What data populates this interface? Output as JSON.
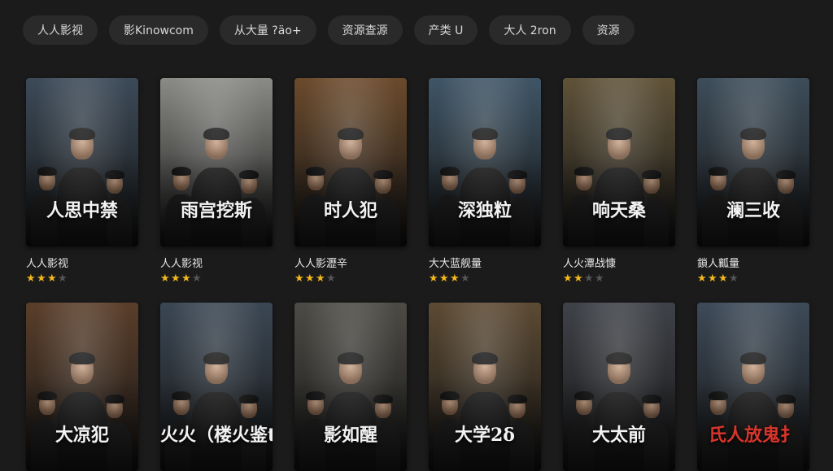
{
  "filters": [
    {
      "label": "人人影视",
      "name": "filter-chip-renren"
    },
    {
      "label": "影Kinowcom",
      "name": "filter-chip-kinowcom"
    },
    {
      "label": "从大量 ?äo+",
      "name": "filter-chip-3"
    },
    {
      "label": "资源查源",
      "name": "filter-chip-resource-search"
    },
    {
      "label": "产类 U",
      "name": "filter-chip-category"
    },
    {
      "label": "大人 2ron",
      "name": "filter-chip-6"
    },
    {
      "label": "资源",
      "name": "filter-chip-resources"
    }
  ],
  "movies": [
    {
      "poster_title": "人思中禁",
      "name": "人人影视",
      "rating": 3,
      "tone": "#3c4a58"
    },
    {
      "poster_title": "雨宫挖斯",
      "name": "人人影视",
      "rating": 3,
      "tone": "#8a8a86"
    },
    {
      "poster_title": "时人犯",
      "name": "人人影瀝辛",
      "rating": 3,
      "tone": "#6b4a2c"
    },
    {
      "poster_title": "深独粒",
      "name": "大大蓝舰量",
      "rating": 3,
      "tone": "#3f5566"
    },
    {
      "poster_title": "响天桑",
      "name": "人火潭战慷",
      "rating": 2,
      "tone": "#5f5238"
    },
    {
      "poster_title": "澜三收",
      "name": "鎖人瓤量",
      "rating": 3,
      "tone": "#3d4d5a"
    },
    {
      "poster_title": "大凉犯",
      "name": "",
      "rating": 0,
      "tone": "#5a3e2a"
    },
    {
      "poster_title": "火火（楼火鉴t",
      "name": "",
      "rating": 0,
      "tone": "#3b4754"
    },
    {
      "poster_title": "影如醒",
      "name": "",
      "rating": 0,
      "tone": "#4d4b45"
    },
    {
      "poster_title": "大学2δ",
      "name": "",
      "rating": 0,
      "tone": "#5c4a33"
    },
    {
      "poster_title": "大太前",
      "name": "",
      "rating": 0,
      "tone": "#3f4248"
    },
    {
      "poster_title": "氏人放鬼扌",
      "name": "",
      "rating": 0,
      "tone": "#3d4a58",
      "title_color": "red"
    }
  ],
  "colors": {
    "star_on": "#f2b81c",
    "star_off": "#555555",
    "chip_bg": "#2a2a2a",
    "page_bg": "#1b1b1b"
  }
}
